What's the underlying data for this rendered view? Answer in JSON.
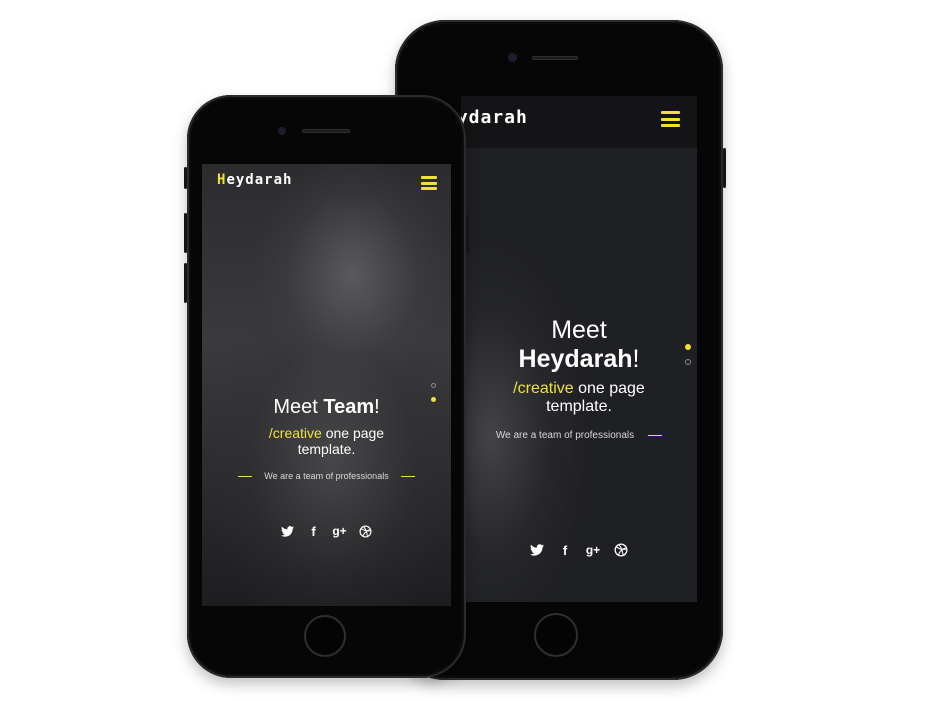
{
  "back_phone": {
    "brand": {
      "first_letter": "",
      "rest": "eydarah"
    },
    "hero": {
      "title_line1": "Meet",
      "title_bold": "Heydarah",
      "title_suffix": "!",
      "sub_accent": "/creative",
      "sub_rest": " one page",
      "sub_line2": "template.",
      "tagline": "We are a team of professionals"
    }
  },
  "front_phone": {
    "brand": {
      "first_letter": "H",
      "rest": "eydarah"
    },
    "hero": {
      "title_prefix": "Meet ",
      "title_bold": "Team",
      "title_suffix": "!",
      "sub_accent": "/creative",
      "sub_rest": " one page",
      "sub_line2": "template.",
      "tagline": "We are a team of professionals"
    }
  },
  "social": {
    "icons": [
      "twitter-icon",
      "facebook-icon",
      "google-plus-icon",
      "dribbble-icon"
    ],
    "facebook_glyph": "f",
    "google_plus_glyph": "g+"
  },
  "colors": {
    "accent": "#f0e13a",
    "screen_bg": "#1e1f23",
    "phone_body": "#060606"
  },
  "slider": {
    "back_active_dot": 1,
    "front_active_dot": 2,
    "dot_count": 2
  }
}
